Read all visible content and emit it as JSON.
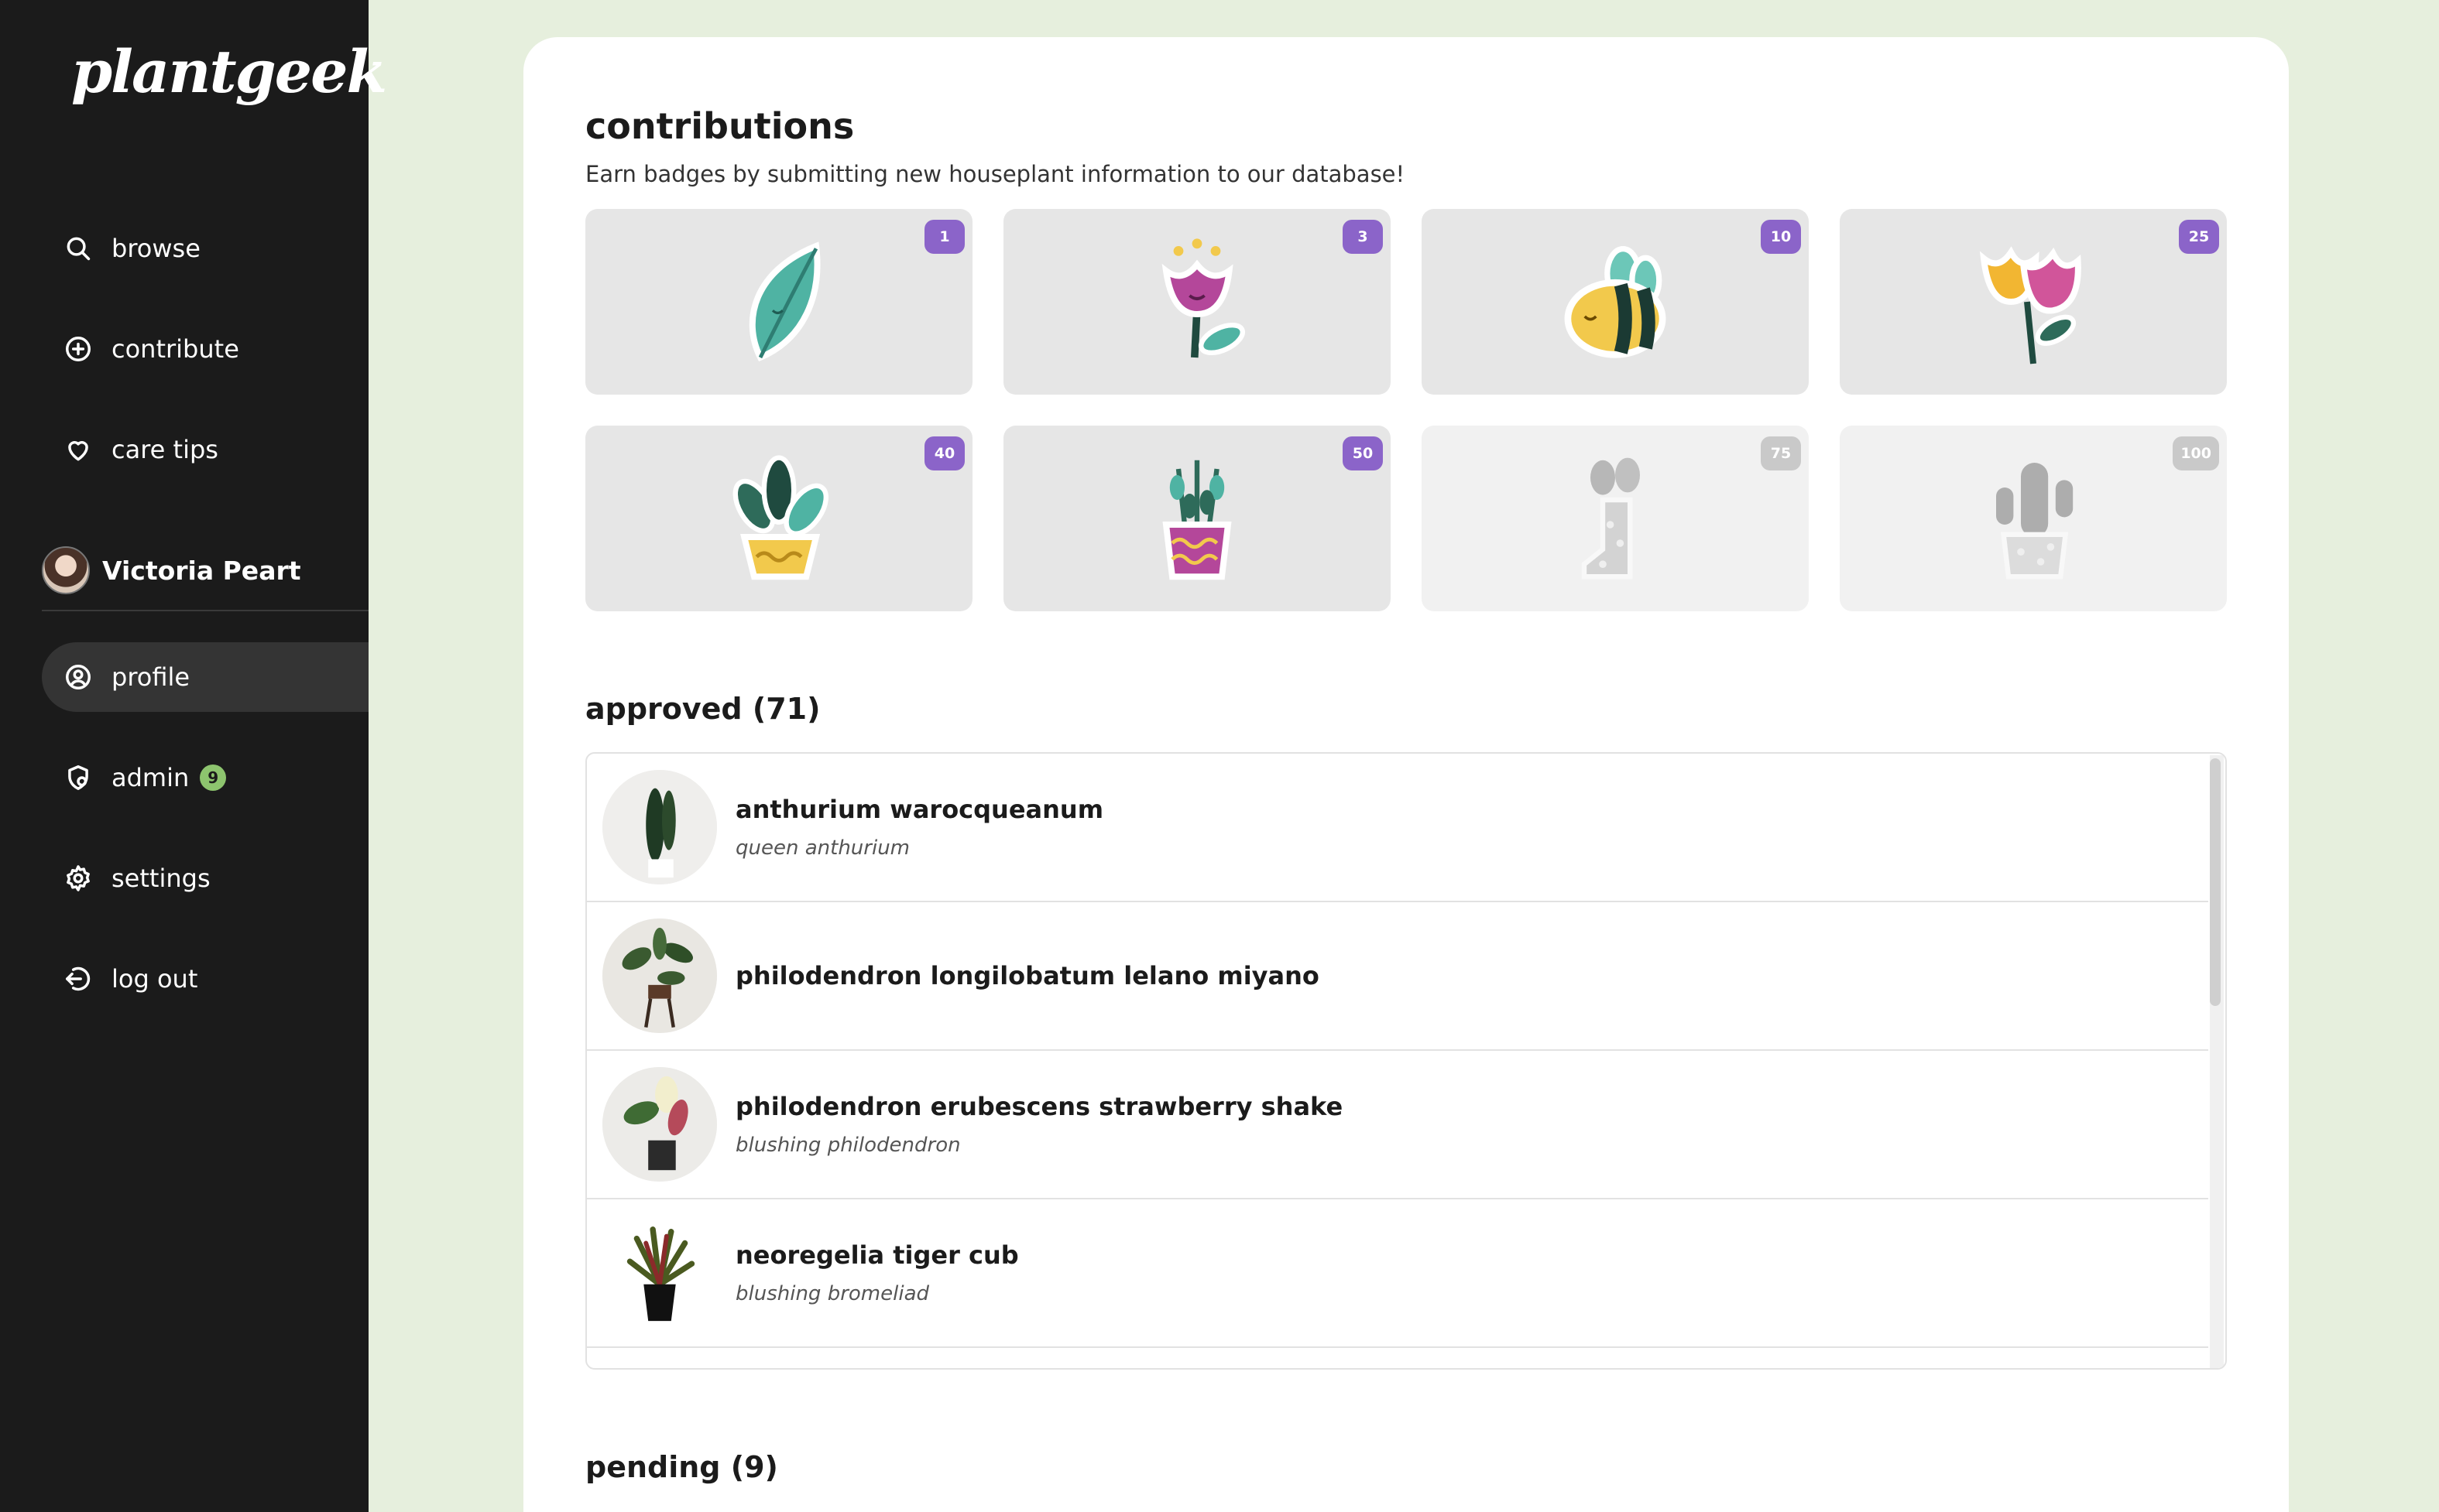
{
  "app": {
    "logo": "plantgeek"
  },
  "nav": {
    "browse": "browse",
    "contribute": "contribute",
    "care_tips": "care tips",
    "profile": "profile",
    "admin": "admin",
    "admin_count": "9",
    "settings": "settings",
    "logout": "log out"
  },
  "user": {
    "name": "Victoria Peart"
  },
  "contributions": {
    "title": "contributions",
    "subtitle": "Earn badges by submitting new houseplant information to our database!",
    "badges": [
      {
        "count": "1",
        "icon": "leaf-icon",
        "unlocked": true
      },
      {
        "count": "3",
        "icon": "tulip-icon",
        "unlocked": true
      },
      {
        "count": "10",
        "icon": "bee-icon",
        "unlocked": true
      },
      {
        "count": "25",
        "icon": "flowers-icon",
        "unlocked": true
      },
      {
        "count": "40",
        "icon": "potted-plant-icon",
        "unlocked": true
      },
      {
        "count": "50",
        "icon": "herb-pot-icon",
        "unlocked": true
      },
      {
        "count": "75",
        "icon": "boot-planter-icon",
        "unlocked": false
      },
      {
        "count": "100",
        "icon": "cactus-icon",
        "unlocked": false
      }
    ]
  },
  "approved": {
    "title": "approved (71)",
    "items": [
      {
        "name": "anthurium warocqueanum",
        "common": "queen anthurium"
      },
      {
        "name": "philodendron longilobatum lelano miyano",
        "common": ""
      },
      {
        "name": "philodendron erubescens strawberry shake",
        "common": "blushing philodendron"
      },
      {
        "name": "neoregelia tiger cub",
        "common": "blushing bromeliad"
      }
    ]
  },
  "pending": {
    "title": "pending (9)"
  },
  "colors": {
    "sidebar": "#1b1b1b",
    "background": "#e6efdd",
    "badge_accent": "#8b64c9",
    "admin_badge": "#8dc46e"
  }
}
